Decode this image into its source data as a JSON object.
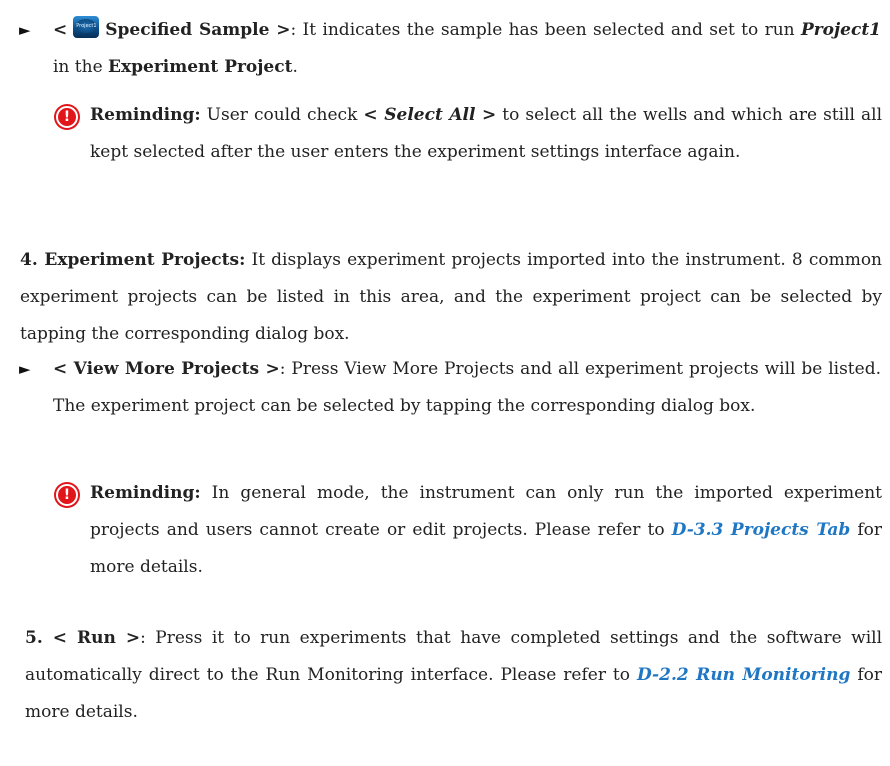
{
  "section_specified": {
    "lt": "<",
    "icon_label": "Project1",
    "term": "Specified Sample >",
    "text1": ": It indicates the sample has been selected and set to run ",
    "project": "Project1",
    "text2": " in the ",
    "area": "Experiment Project",
    "period": "."
  },
  "reminder1": {
    "label": "Reminding:",
    "text1": " User could check ",
    "select_all": "< Select All >",
    "text2": " to select all the wells and which are still all kept selected after the user enters the experiment settings interface again."
  },
  "item4": {
    "term": "4. Experiment Projects:",
    "text": " It displays experiment projects imported into the instrument. 8 common experiment projects can be listed in this area, and the experiment project can be selected by tapping the corresponding dialog box."
  },
  "view_more": {
    "term": "< View More Projects >",
    "text": ": Press View More Projects and all experiment projects will be listed. The experiment project can be selected by tapping the corresponding dialog box."
  },
  "reminder2": {
    "label": "Reminding:",
    "text1": " In general mode, the instrument can only run the imported experiment projects and users cannot create or edit projects. Please refer to ",
    "link": "D-3.3 Projects Tab",
    "text2": " for more details."
  },
  "item5": {
    "term": "5. < Run >",
    "text1": ": Press it to run experiments that have completed settings and the software will automatically direct to the Run Monitoring interface. Please refer to ",
    "link": "D-2.2 Run Monitoring",
    "text2": " for more details."
  },
  "symbols": {
    "arrow_glyph": "►",
    "warn_glyph": "!",
    "warn_color": "#e0161b",
    "link_color": "#1f77c4"
  }
}
